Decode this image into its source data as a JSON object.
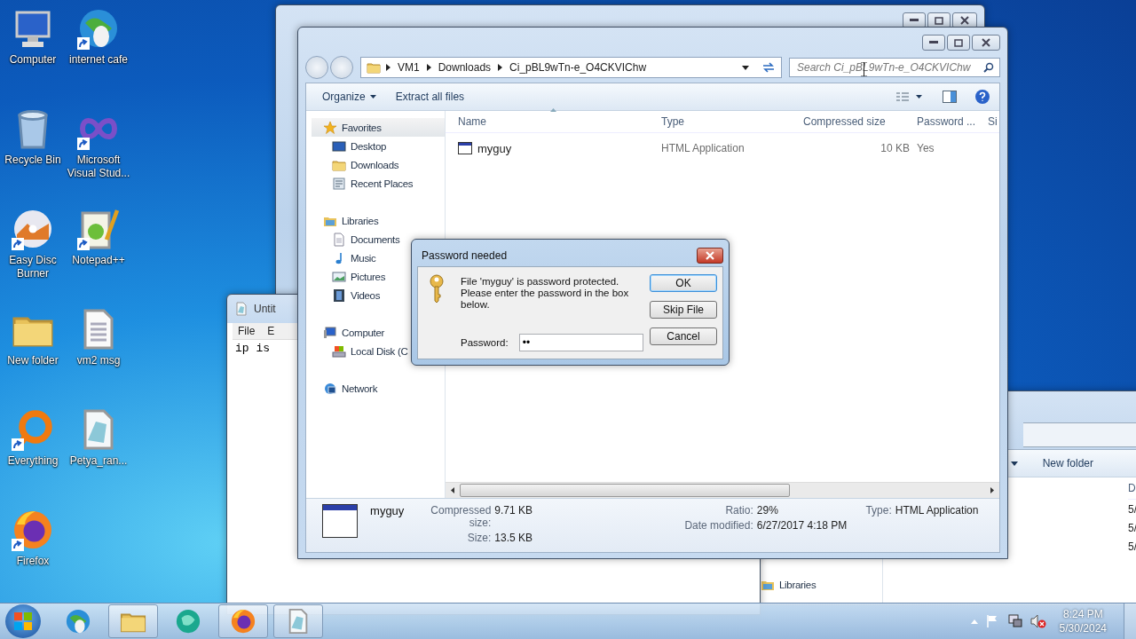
{
  "desktop_icons": [
    {
      "label": "Computer",
      "kind": "monitor",
      "shortcut": false
    },
    {
      "label": "internet cafe",
      "kind": "globe",
      "shortcut": true
    },
    {
      "label": "Recycle Bin",
      "kind": "bin",
      "shortcut": false
    },
    {
      "label": "Microsoft Visual Stud...",
      "kind": "infinity",
      "shortcut": true
    },
    {
      "label": "Easy Disc Burner",
      "kind": "disc",
      "shortcut": true
    },
    {
      "label": "Notepad++",
      "kind": "notepad",
      "shortcut": true
    },
    {
      "label": "New folder",
      "kind": "folder",
      "shortcut": false
    },
    {
      "label": "vm2 msg",
      "kind": "textfile",
      "shortcut": false
    },
    {
      "label": "Everything",
      "kind": "ring",
      "shortcut": true
    },
    {
      "label": "Petya_ran...",
      "kind": "notefile",
      "shortcut": false
    },
    {
      "label": "Firefox",
      "kind": "fox",
      "shortcut": true
    }
  ],
  "notepad": {
    "title": "Untit",
    "menu": [
      "File",
      "E"
    ],
    "text": "ip is"
  },
  "back_explorer": {
    "toolbar_button": "New folder",
    "column": "D",
    "cells": [
      "5/",
      "5/",
      "5/"
    ],
    "nav_item": "Libraries"
  },
  "explorer": {
    "breadcrumb": [
      "VM1",
      "Downloads",
      "Ci_pBL9wTn-e_O4CKVIChw"
    ],
    "search": {
      "placeholder": "Search Ci_pBL9wTn-e_O4CKVIChw"
    },
    "toolbar": [
      {
        "label": "Organize",
        "dropdown": true
      },
      {
        "label": "Extract all files",
        "dropdown": false
      }
    ],
    "nav": [
      {
        "label": "Favorites",
        "kind": "star",
        "selected": true,
        "children": [
          {
            "label": "Desktop",
            "kind": "desktop",
            "selected": false
          },
          {
            "label": "Downloads",
            "kind": "folder",
            "selected": false
          },
          {
            "label": "Recent Places",
            "kind": "places",
            "selected": false
          }
        ]
      },
      {
        "label": "Libraries",
        "kind": "library",
        "selected": false,
        "children": [
          {
            "label": "Documents",
            "kind": "doc",
            "selected": false
          },
          {
            "label": "Music",
            "kind": "music",
            "selected": false
          },
          {
            "label": "Pictures",
            "kind": "picture",
            "selected": false
          },
          {
            "label": "Videos",
            "kind": "video",
            "selected": false
          }
        ]
      },
      {
        "label": "Computer",
        "kind": "computer",
        "selected": false,
        "children": [
          {
            "label": "Local Disk (C",
            "kind": "disk",
            "selected": false
          }
        ]
      },
      {
        "label": "Network",
        "kind": "network",
        "selected": false
      }
    ],
    "columns": [
      "Name",
      "Type",
      "Compressed size",
      "Password ...",
      "Si"
    ],
    "rows": [
      {
        "name": "myguy",
        "type": "HTML Application",
        "compressed_size": "10 KB",
        "password": "Yes",
        "selected": false
      }
    ],
    "details": {
      "name": "myguy",
      "groups": [
        [
          {
            "label": "Compressed size:",
            "value": "9.71 KB"
          },
          {
            "label": "Size:",
            "value": "13.5 KB"
          }
        ],
        [
          {
            "label": "Ratio:",
            "value": "29%"
          },
          {
            "label": "Date modified:",
            "value": "6/27/2017 4:18 PM"
          }
        ],
        [
          {
            "label": "Type:",
            "value": "HTML Application"
          }
        ]
      ]
    }
  },
  "dialog": {
    "title": "Password needed",
    "message": "File 'myguy' is password protected.  Please enter the password in the box below.",
    "password_label": "Password:",
    "password_value": "••",
    "buttons": [
      {
        "label": "OK",
        "default": true
      },
      {
        "label": "Skip File",
        "default": false
      },
      {
        "label": "Cancel",
        "default": false
      }
    ]
  },
  "taskbar": {
    "items": [
      {
        "kind": "globe",
        "open": false
      },
      {
        "kind": "folder",
        "open": true
      },
      {
        "kind": "orb",
        "open": false
      },
      {
        "kind": "fox",
        "open": true
      },
      {
        "kind": "notefile",
        "open": true
      }
    ],
    "clock": {
      "time": "8:24 PM",
      "date": "5/30/2024"
    }
  }
}
